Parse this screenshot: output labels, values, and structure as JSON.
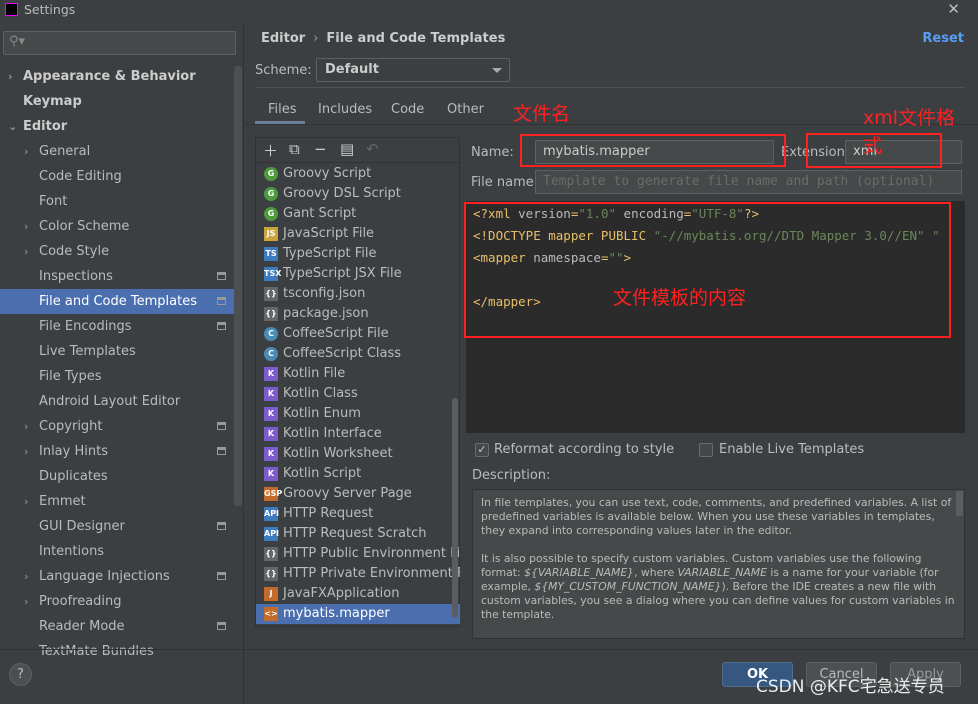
{
  "window": {
    "title": "Settings"
  },
  "search": {
    "placeholder": ""
  },
  "sidebar": {
    "items": [
      {
        "label": "Appearance & Behavior",
        "level": 0,
        "bold": true,
        "chevron": "right"
      },
      {
        "label": "Keymap",
        "level": 0,
        "bold": true
      },
      {
        "label": "Editor",
        "level": 0,
        "bold": true,
        "chevron": "down"
      },
      {
        "label": "General",
        "level": 1,
        "chevron": "right"
      },
      {
        "label": "Code Editing",
        "level": 1
      },
      {
        "label": "Font",
        "level": 1
      },
      {
        "label": "Color Scheme",
        "level": 1,
        "chevron": "right"
      },
      {
        "label": "Code Style",
        "level": 1,
        "chevron": "right"
      },
      {
        "label": "Inspections",
        "level": 1,
        "project": true
      },
      {
        "label": "File and Code Templates",
        "level": 1,
        "project": true,
        "selected": true
      },
      {
        "label": "File Encodings",
        "level": 1,
        "project": true
      },
      {
        "label": "Live Templates",
        "level": 1
      },
      {
        "label": "File Types",
        "level": 1
      },
      {
        "label": "Android Layout Editor",
        "level": 1
      },
      {
        "label": "Copyright",
        "level": 1,
        "chevron": "right",
        "project": true
      },
      {
        "label": "Inlay Hints",
        "level": 1,
        "chevron": "right",
        "project": true
      },
      {
        "label": "Duplicates",
        "level": 1
      },
      {
        "label": "Emmet",
        "level": 1,
        "chevron": "right"
      },
      {
        "label": "GUI Designer",
        "level": 1,
        "project": true
      },
      {
        "label": "Intentions",
        "level": 1
      },
      {
        "label": "Language Injections",
        "level": 1,
        "chevron": "right",
        "project": true
      },
      {
        "label": "Proofreading",
        "level": 1,
        "chevron": "right"
      },
      {
        "label": "Reader Mode",
        "level": 1,
        "project": true
      },
      {
        "label": "TextMate Bundles",
        "level": 1
      }
    ]
  },
  "breadcrumb": {
    "parent": "Editor",
    "current": "File and Code Templates"
  },
  "reset_label": "Reset",
  "scheme": {
    "label": "Scheme:",
    "value": "Default"
  },
  "tabs": [
    "Files",
    "Includes",
    "Code",
    "Other"
  ],
  "toolbar_icons": [
    "add-icon",
    "add-child-icon",
    "remove-icon",
    "copy-icon",
    "undo-icon"
  ],
  "files": [
    {
      "label": "Groovy Script",
      "icon": "groovy-icon",
      "badge": "G",
      "color": "#4e9a3f"
    },
    {
      "label": "Groovy DSL Script",
      "icon": "groovy-icon",
      "badge": "G",
      "color": "#4e9a3f"
    },
    {
      "label": "Gant Script",
      "icon": "groovy-icon",
      "badge": "G",
      "color": "#4e9a3f"
    },
    {
      "label": "JavaScript File",
      "icon": "javascript-icon",
      "badge": "JS",
      "color": "#c9a53a"
    },
    {
      "label": "TypeScript File",
      "icon": "typescript-icon",
      "badge": "TS",
      "color": "#3c7bbd"
    },
    {
      "label": "TypeScript JSX File",
      "icon": "tsx-icon",
      "badge": "TSX",
      "color": "#3c7bbd"
    },
    {
      "label": "tsconfig.json",
      "icon": "json-icon",
      "badge": "{}",
      "color": "#666"
    },
    {
      "label": "package.json",
      "icon": "json-icon",
      "badge": "{}",
      "color": "#666"
    },
    {
      "label": "CoffeeScript File",
      "icon": "coffee-icon",
      "badge": "C",
      "color": "#4a8bb5"
    },
    {
      "label": "CoffeeScript Class",
      "icon": "coffee-icon",
      "badge": "C",
      "color": "#4a8bb5"
    },
    {
      "label": "Kotlin File",
      "icon": "kotlin-icon",
      "badge": "K",
      "color": "#7b5ccc"
    },
    {
      "label": "Kotlin Class",
      "icon": "kotlin-icon",
      "badge": "K",
      "color": "#7b5ccc"
    },
    {
      "label": "Kotlin Enum",
      "icon": "kotlin-icon",
      "badge": "K",
      "color": "#7b5ccc"
    },
    {
      "label": "Kotlin Interface",
      "icon": "kotlin-icon",
      "badge": "K",
      "color": "#7b5ccc"
    },
    {
      "label": "Kotlin Worksheet",
      "icon": "kotlin-icon",
      "badge": "K",
      "color": "#7b5ccc"
    },
    {
      "label": "Kotlin Script",
      "icon": "kotlin-icon",
      "badge": "K",
      "color": "#7b5ccc"
    },
    {
      "label": "Groovy Server Page",
      "icon": "gsp-icon",
      "badge": "GSP",
      "color": "#c46b2c"
    },
    {
      "label": "HTTP Request",
      "icon": "api-icon",
      "badge": "API",
      "color": "#3c7bbd"
    },
    {
      "label": "HTTP Request Scratch",
      "icon": "api-icon",
      "badge": "API",
      "color": "#3c7bbd"
    },
    {
      "label": "HTTP Public Environment File",
      "icon": "json-icon",
      "badge": "{}",
      "color": "#666"
    },
    {
      "label": "HTTP Private Environment File",
      "icon": "json-icon",
      "badge": "{}",
      "color": "#666"
    },
    {
      "label": "JavaFXApplication",
      "icon": "java-icon",
      "badge": "J",
      "color": "#c46b2c"
    },
    {
      "label": "mybatis.mapper",
      "icon": "xml-icon",
      "badge": "<>",
      "color": "#c46b2c",
      "selected": true
    }
  ],
  "form": {
    "name_label": "Name:",
    "name_value": "mybatis.mapper",
    "extension_label": "Extension:",
    "extension_value": "xml",
    "filename_label": "File name:",
    "filename_placeholder": "Template to generate file name and path (optional)"
  },
  "code": [
    [
      [
        "tg",
        "<?xml "
      ],
      [
        "at",
        "version"
      ],
      [
        "tg",
        "="
      ],
      [
        "st",
        "\"1.0\""
      ],
      [
        "at",
        " encoding"
      ],
      [
        "tg",
        "="
      ],
      [
        "st",
        "\"UTF-8\""
      ],
      [
        "tg",
        "?>"
      ]
    ],
    [
      [
        "tg",
        "<!DOCTYPE mapper PUBLIC "
      ],
      [
        "st",
        "\"-//mybatis.org//DTD Mapper 3.0//EN\" \""
      ]
    ],
    [
      [
        "tg",
        "<mapper "
      ],
      [
        "at",
        "namespace"
      ],
      [
        "tg",
        "="
      ],
      [
        "st",
        "\"\""
      ],
      [
        "tg",
        ">"
      ]
    ],
    [],
    [
      [
        "tg",
        "</mapper>"
      ]
    ]
  ],
  "options": {
    "reformat_label": "Reformat according to style",
    "reformat_checked": true,
    "live_label": "Enable Live Templates",
    "live_checked": false
  },
  "description": {
    "label": "Description:",
    "p1": "In file templates, you can use text, code, comments, and predefined variables. A list of predefined variables is available below. When you use these variables in templates, they expand into corresponding values later in the editor.",
    "p2a": "It is also possible to specify custom variables. Custom variables use the following format: ",
    "v1": "${VARIABLE_NAME}",
    "p2b": ", where ",
    "v2": "VARIABLE_NAME",
    "p2c": " is a name for your variable (for example, ",
    "v3": "${MY_CUSTOM_FUNCTION_NAME}",
    "p2d": "). Before the IDE creates a new file with custom variables, you see a dialog where you can define values for custom variables in the template."
  },
  "buttons": {
    "ok": "OK",
    "cancel": "Cancel",
    "apply": "Apply",
    "help": "?"
  },
  "annotations": {
    "name": "文件名",
    "ext": "xml文件格式",
    "content": "文件模板的内容",
    "color": "#ff2020"
  },
  "watermark": "CSDN @KFC宅急送专员"
}
